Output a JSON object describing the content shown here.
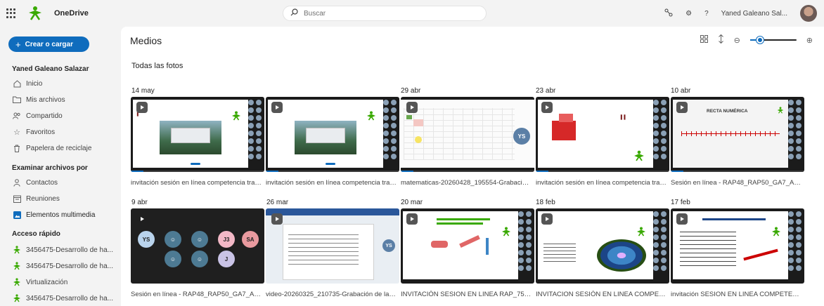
{
  "app": {
    "brand": "OneDrive",
    "search_placeholder": "Buscar",
    "user_name": "Yaned Galeano Sal..."
  },
  "sidebar": {
    "create_label": "Crear o cargar",
    "owner": "Yaned Galeano Salazar",
    "nav": [
      {
        "label": "Inicio",
        "icon": "home-icon"
      },
      {
        "label": "Mis archivos",
        "icon": "folder-icon"
      },
      {
        "label": "Compartido",
        "icon": "people-icon"
      },
      {
        "label": "Favoritos",
        "icon": "star-icon"
      },
      {
        "label": "Papelera de reciclaje",
        "icon": "trash-icon"
      }
    ],
    "browse_heading": "Examinar archivos por",
    "browse": [
      {
        "label": "Contactos",
        "icon": "person-icon"
      },
      {
        "label": "Reuniones",
        "icon": "calendar-icon"
      },
      {
        "label": "Elementos multimedia",
        "icon": "media-icon"
      }
    ],
    "quick_heading": "Acceso rápido",
    "quick": [
      {
        "label": "3456475-Desarrollo de ha..."
      },
      {
        "label": "3456475-Desarrollo de ha..."
      },
      {
        "label": "Virtualización"
      },
      {
        "label": "3456475-Desarrollo de ha..."
      }
    ]
  },
  "main": {
    "title": "Medios",
    "section": "Todas las fotos",
    "row1": [
      {
        "date": "14 may",
        "caption": "invitación sesión en línea competencia tran...",
        "slide_title": ""
      },
      {
        "date": "",
        "caption": "invitación sesión en línea competencia tran...",
        "slide_title": ""
      },
      {
        "date": "29 abr",
        "caption": "matematicas-20260428_195554-Grabación ...",
        "slide_title": ""
      },
      {
        "date": "23 abr",
        "caption": "invitación sesión en línea competencia tran...",
        "slide_title": ""
      },
      {
        "date": "10 abr",
        "caption": "Sesión en línea - RAP48_RAP50_GA7_AA1_E...",
        "slide_title": "RECTA NUMÉRICA"
      }
    ],
    "row2": [
      {
        "date": "9 abr",
        "caption": "Sesión en línea - RAP48_RAP50_GA7_AA1_E...",
        "participants": [
          "YS",
          "J3",
          "SA",
          "J"
        ]
      },
      {
        "date": "26 mar",
        "caption": "video-20260325_210735-Grabación de la re..."
      },
      {
        "date": "20 mar",
        "caption": "INVITACIÓN SESION EN LINEA RAP_75_77_..."
      },
      {
        "date": "18 feb",
        "caption": "INVITACION SESIÓN EN LINEA COMPETEN..."
      },
      {
        "date": "17 feb",
        "caption": "invitación SESION EN LINEA COMPETENCIA..."
      }
    ]
  },
  "colors": {
    "accent": "#0f6cbd",
    "sena_green": "#39a900"
  }
}
